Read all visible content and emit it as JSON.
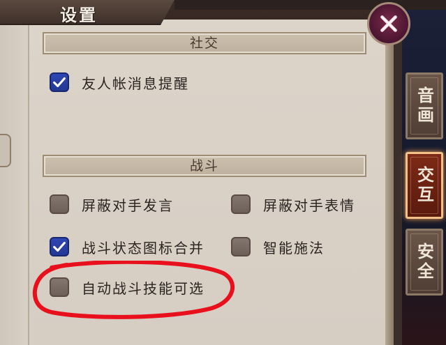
{
  "window": {
    "title": "设置"
  },
  "close_button": {
    "icon": "close-icon"
  },
  "tabs": [
    {
      "label": "音画",
      "active": false
    },
    {
      "label": "交互",
      "active": true
    },
    {
      "label": "安全",
      "active": false
    }
  ],
  "sections": {
    "social": {
      "title": "社交",
      "options": [
        {
          "label": "友人帐消息提醒",
          "checked": true
        }
      ]
    },
    "battle": {
      "title": "战斗",
      "options": [
        {
          "label": "屏蔽对手发言",
          "checked": false
        },
        {
          "label": "屏蔽对手表情",
          "checked": false
        },
        {
          "label": "战斗状态图标合并",
          "checked": true
        },
        {
          "label": "智能施法",
          "checked": false
        },
        {
          "label": "自动战斗技能可选",
          "checked": false
        }
      ]
    }
  },
  "colors": {
    "checked_fill": "#2f46b4",
    "unchecked_fill": "#7a6e66",
    "annotation": "#e8101c",
    "active_tab_border": "#f4c08a"
  }
}
